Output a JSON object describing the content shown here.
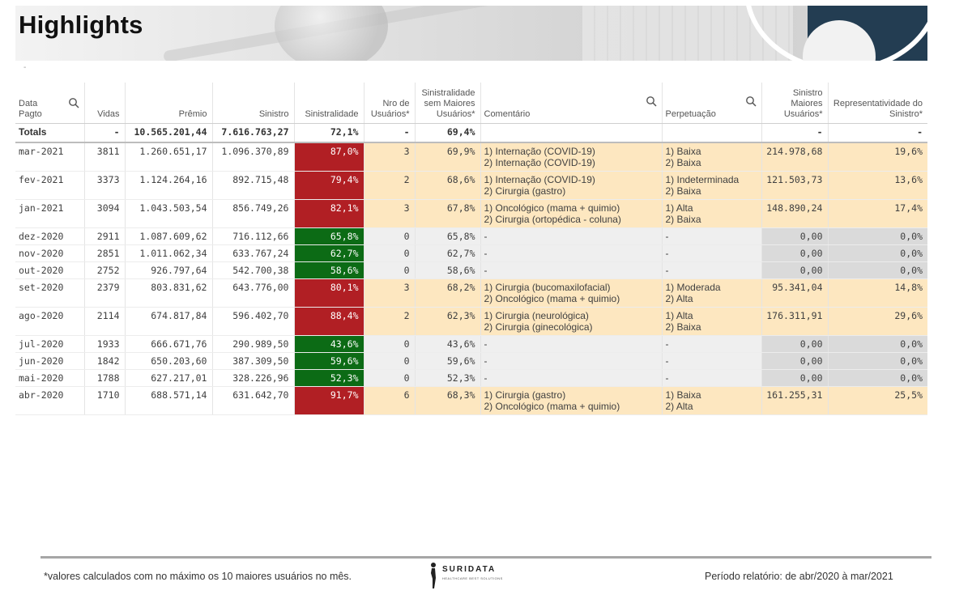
{
  "title": "Highlights",
  "banner_marker": "-",
  "headers": {
    "data_pagto": "Data\nPagto",
    "vidas": "Vidas",
    "premio": "Prêmio",
    "sinistro": "Sinistro",
    "sinistralidade": "Sinistralidade",
    "nro_usuarios": "Nro de\nUsuários*",
    "sin_sem_maiores": "Sinistralidade\nsem Maiores\nUsuários*",
    "comentario": "Comentário",
    "perpetuacao": "Perpetuação",
    "sinistro_maiores": "Sinistro\nMaiores\nUsuários*",
    "representatividade": "Representatividade do\nSinistro*"
  },
  "totals": {
    "label": "Totals",
    "vidas": "-",
    "premio": "10.565.201,44",
    "sinistro": "7.616.763,27",
    "sinistralidade": "72,1%",
    "nro": "-",
    "sem_maiores": "69,4%",
    "comentario": "",
    "perpetuacao": "",
    "sinistro_maiores": "-",
    "representatividade": "-"
  },
  "rows": [
    {
      "data": "mar-2021",
      "vidas": "3811",
      "premio": "1.260.651,17",
      "sinistro": "1.096.370,89",
      "sinistralidade": "87,0%",
      "sin_status": "red",
      "nro": "3",
      "sem_maiores": "69,9%",
      "comentario1": "1) Internação (COVID-19)",
      "comentario2": "2) Internação (COVID-19)",
      "perp1": "1) Baixa",
      "perp2": "2) Baixa",
      "sinistro_maiores": "214.978,68",
      "representatividade": "19,6%"
    },
    {
      "data": "fev-2021",
      "vidas": "3373",
      "premio": "1.124.264,16",
      "sinistro": "892.715,48",
      "sinistralidade": "79,4%",
      "sin_status": "red",
      "nro": "2",
      "sem_maiores": "68,6%",
      "comentario1": "1) Internação (COVID-19)",
      "comentario2": "2) Cirurgia (gastro)",
      "perp1": "1) Indeterminada",
      "perp2": "2) Baixa",
      "sinistro_maiores": "121.503,73",
      "representatividade": "13,6%"
    },
    {
      "data": "jan-2021",
      "vidas": "3094",
      "premio": "1.043.503,54",
      "sinistro": "856.749,26",
      "sinistralidade": "82,1%",
      "sin_status": "red",
      "nro": "3",
      "sem_maiores": "67,8%",
      "comentario1": "1) Oncológico (mama + quimio)",
      "comentario2": "2) Cirurgia (ortopédica - coluna)",
      "perp1": "1) Alta",
      "perp2": "2) Baixa",
      "sinistro_maiores": "148.890,24",
      "representatividade": "17,4%"
    },
    {
      "data": "dez-2020",
      "vidas": "2911",
      "premio": "1.087.609,62",
      "sinistro": "716.112,66",
      "sinistralidade": "65,8%",
      "sin_status": "green",
      "nro": "0",
      "sem_maiores": "65,8%",
      "comentario1": "-",
      "comentario2": "",
      "perp1": "-",
      "perp2": "",
      "sinistro_maiores": "0,00",
      "representatividade": "0,0%"
    },
    {
      "data": "nov-2020",
      "vidas": "2851",
      "premio": "1.011.062,34",
      "sinistro": "633.767,24",
      "sinistralidade": "62,7%",
      "sin_status": "green",
      "nro": "0",
      "sem_maiores": "62,7%",
      "comentario1": "-",
      "comentario2": "",
      "perp1": "-",
      "perp2": "",
      "sinistro_maiores": "0,00",
      "representatividade": "0,0%"
    },
    {
      "data": "out-2020",
      "vidas": "2752",
      "premio": "926.797,64",
      "sinistro": "542.700,38",
      "sinistralidade": "58,6%",
      "sin_status": "green",
      "nro": "0",
      "sem_maiores": "58,6%",
      "comentario1": "-",
      "comentario2": "",
      "perp1": "-",
      "perp2": "",
      "sinistro_maiores": "0,00",
      "representatividade": "0,0%"
    },
    {
      "data": "set-2020",
      "vidas": "2379",
      "premio": "803.831,62",
      "sinistro": "643.776,00",
      "sinistralidade": "80,1%",
      "sin_status": "red",
      "nro": "3",
      "sem_maiores": "68,2%",
      "comentario1": "1) Cirurgia (bucomaxilofacial)",
      "comentario2": "2) Oncológico (mama + quimio)",
      "perp1": "1) Moderada",
      "perp2": "2) Alta",
      "sinistro_maiores": "95.341,04",
      "representatividade": "14,8%"
    },
    {
      "data": "ago-2020",
      "vidas": "2114",
      "premio": "674.817,84",
      "sinistro": "596.402,70",
      "sinistralidade": "88,4%",
      "sin_status": "red",
      "nro": "2",
      "sem_maiores": "62,3%",
      "comentario1": "1) Cirurgia (neurológica)",
      "comentario2": "2) Cirurgia (ginecológica)",
      "perp1": "1) Alta",
      "perp2": "2) Baixa",
      "sinistro_maiores": "176.311,91",
      "representatividade": "29,6%"
    },
    {
      "data": "jul-2020",
      "vidas": "1933",
      "premio": "666.671,76",
      "sinistro": "290.989,50",
      "sinistralidade": "43,6%",
      "sin_status": "green",
      "nro": "0",
      "sem_maiores": "43,6%",
      "comentario1": "-",
      "comentario2": "",
      "perp1": "-",
      "perp2": "",
      "sinistro_maiores": "0,00",
      "representatividade": "0,0%"
    },
    {
      "data": "jun-2020",
      "vidas": "1842",
      "premio": "650.203,60",
      "sinistro": "387.309,50",
      "sinistralidade": "59,6%",
      "sin_status": "green",
      "nro": "0",
      "sem_maiores": "59,6%",
      "comentario1": "-",
      "comentario2": "",
      "perp1": "-",
      "perp2": "",
      "sinistro_maiores": "0,00",
      "representatividade": "0,0%"
    },
    {
      "data": "mai-2020",
      "vidas": "1788",
      "premio": "627.217,01",
      "sinistro": "328.226,96",
      "sinistralidade": "52,3%",
      "sin_status": "green",
      "nro": "0",
      "sem_maiores": "52,3%",
      "comentario1": "-",
      "comentario2": "",
      "perp1": "-",
      "perp2": "",
      "sinistro_maiores": "0,00",
      "representatividade": "0,0%"
    },
    {
      "data": "abr-2020",
      "vidas": "1710",
      "premio": "688.571,14",
      "sinistro": "631.642,70",
      "sinistralidade": "91,7%",
      "sin_status": "red",
      "nro": "6",
      "sem_maiores": "68,3%",
      "comentario1": "1) Cirurgia (gastro)",
      "comentario2": "2) Oncológico (mama + quimio)",
      "perp1": "1) Baixa",
      "perp2": "2) Alta",
      "sinistro_maiores": "161.255,31",
      "representatividade": "25,5%"
    }
  ],
  "colors": {
    "status_red": "#b11f24",
    "status_green": "#0c6b15",
    "highlight_row": "#fde7c0",
    "neutral_row": "#efefef",
    "banner_navy": "#233d52"
  },
  "icons": {
    "header_search": "search-icon",
    "logo": "suridata-logo"
  },
  "footer": {
    "note": "*valores calculados com no máximo os 10 maiores usuários no mês.",
    "period": "Período relatório: de abr/2020 à mar/2021",
    "logo_name": "SURIDATA",
    "logo_tag": "HEALTHCARE BEST SOLUTIONS"
  }
}
